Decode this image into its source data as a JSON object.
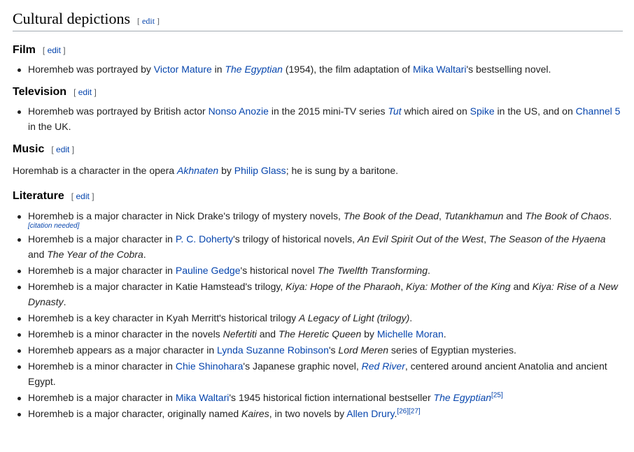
{
  "heading": {
    "title": "Cultural depictions",
    "edit": "edit"
  },
  "bracket_open": "[",
  "bracket_close": "]",
  "film": {
    "title": "Film",
    "edit": "edit",
    "items": [
      [
        "Horemheb was portrayed by ",
        {
          "a": "Victor Mature"
        },
        " in ",
        {
          "ai": "The Egyptian"
        },
        " (1954), the film adaptation of ",
        {
          "a": "Mika Waltari"
        },
        "'s bestselling novel."
      ]
    ]
  },
  "television": {
    "title": "Television",
    "edit": "edit",
    "items": [
      [
        "Horemheb was portrayed by British actor ",
        {
          "a": "Nonso Anozie"
        },
        " in the 2015 mini-TV series ",
        {
          "ai": "Tut"
        },
        " which aired on ",
        {
          "a": "Spike"
        },
        " in the US, and on ",
        {
          "a": "Channel 5"
        },
        " in the UK."
      ]
    ]
  },
  "music": {
    "title": "Music",
    "edit": "edit",
    "para": [
      "Horemhab is a character in the opera ",
      {
        "ai": "Akhnaten"
      },
      " by ",
      {
        "a": "Philip Glass"
      },
      "; he is sung by a baritone."
    ]
  },
  "literature": {
    "title": "Literature",
    "edit": "edit",
    "items": [
      [
        "Horemheb is a major character in Nick Drake's trilogy of mystery novels, ",
        {
          "i": "The Book of the Dead"
        },
        ", ",
        {
          "i": "Tutankhamun"
        },
        " and ",
        {
          "i": "The Book of Chaos"
        },
        ".",
        {
          "cite": "[citation needed]"
        }
      ],
      [
        "Horemheb is a major character in ",
        {
          "a": "P. C. Doherty"
        },
        "'s trilogy of historical novels, ",
        {
          "i": "An Evil Spirit Out of the West"
        },
        ", ",
        {
          "i": "The Season of the Hyaena"
        },
        " and ",
        {
          "i": "The Year of the Cobra"
        },
        "."
      ],
      [
        "Horemheb is a major character in ",
        {
          "a": "Pauline Gedge"
        },
        "'s historical novel ",
        {
          "i": "The Twelfth Transforming"
        },
        "."
      ],
      [
        "Horemheb is a major character in Katie Hamstead's trilogy, ",
        {
          "i": "Kiya: Hope of the Pharaoh"
        },
        ", ",
        {
          "i": "Kiya: Mother of the King"
        },
        " and ",
        {
          "i": "Kiya: Rise of a New Dynasty"
        },
        "."
      ],
      [
        "Horemheb is a key character in Kyah Merritt's historical trilogy ",
        {
          "i": "A Legacy of Light (trilogy)"
        },
        "."
      ],
      [
        "Horemheb is a minor character in the novels ",
        {
          "i": "Nefertiti"
        },
        " and ",
        {
          "i": "The Heretic Queen"
        },
        " by ",
        {
          "a": "Michelle Moran"
        },
        "."
      ],
      [
        "Horemheb appears as a major character in ",
        {
          "a": "Lynda Suzanne Robinson"
        },
        "'s ",
        {
          "i": "Lord Meren"
        },
        " series of Egyptian mysteries."
      ],
      [
        "Horemheb is a minor character in ",
        {
          "a": "Chie Shinohara"
        },
        "'s Japanese graphic novel, ",
        {
          "ai": "Red River"
        },
        ", centered around ancient Anatolia and ancient Egypt."
      ],
      [
        "Horemheb is a major character in ",
        {
          "a": "Mika Waltari"
        },
        "'s 1945 historical fiction international bestseller ",
        {
          "ai": "The Egyptian"
        },
        {
          "sup": "[25]"
        }
      ],
      [
        "Horemheb is a major character, originally named ",
        {
          "i": "Kaires"
        },
        ", in two novels by ",
        {
          "a": "Allen Drury"
        },
        ".",
        {
          "sup": "[26]"
        },
        {
          "sup": "[27]"
        }
      ]
    ]
  }
}
